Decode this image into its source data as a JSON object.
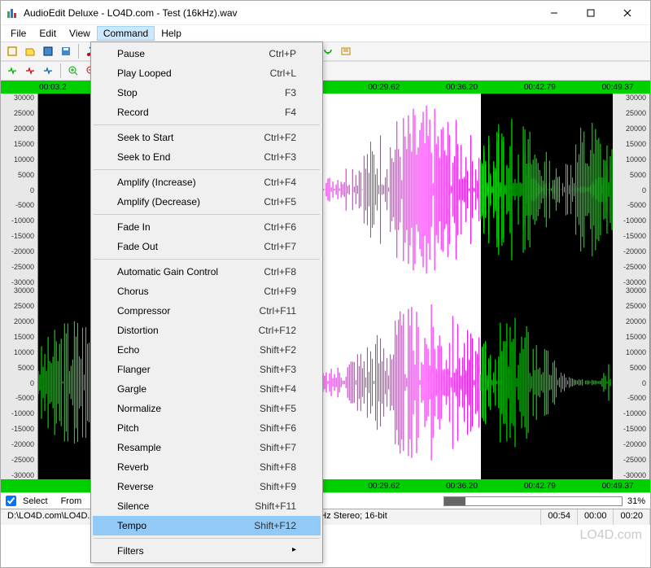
{
  "window": {
    "title": "AudioEdit Deluxe  -  LO4D.com - Test (16kHz).wav"
  },
  "menubar": {
    "items": [
      "File",
      "Edit",
      "View",
      "Command",
      "Help"
    ],
    "open_index": 3
  },
  "command_menu": {
    "groups": [
      [
        {
          "label": "Pause",
          "shortcut": "Ctrl+P"
        },
        {
          "label": "Play Looped",
          "shortcut": "Ctrl+L"
        },
        {
          "label": "Stop",
          "shortcut": "F3"
        },
        {
          "label": "Record",
          "shortcut": "F4"
        }
      ],
      [
        {
          "label": "Seek to Start",
          "shortcut": "Ctrl+F2"
        },
        {
          "label": "Seek to End",
          "shortcut": "Ctrl+F3"
        }
      ],
      [
        {
          "label": "Amplify (Increase)",
          "shortcut": "Ctrl+F4"
        },
        {
          "label": "Amplify (Decrease)",
          "shortcut": "Ctrl+F5"
        }
      ],
      [
        {
          "label": "Fade In",
          "shortcut": "Ctrl+F6"
        },
        {
          "label": "Fade Out",
          "shortcut": "Ctrl+F7"
        }
      ],
      [
        {
          "label": "Automatic Gain Control",
          "shortcut": "Ctrl+F8"
        },
        {
          "label": "Chorus",
          "shortcut": "Ctrl+F9"
        },
        {
          "label": "Compressor",
          "shortcut": "Ctrl+F11"
        },
        {
          "label": "Distortion",
          "shortcut": "Ctrl+F12"
        },
        {
          "label": "Echo",
          "shortcut": "Shift+F2"
        },
        {
          "label": "Flanger",
          "shortcut": "Shift+F3"
        },
        {
          "label": "Gargle",
          "shortcut": "Shift+F4"
        },
        {
          "label": "Normalize",
          "shortcut": "Shift+F5"
        },
        {
          "label": "Pitch",
          "shortcut": "Shift+F6"
        },
        {
          "label": "Resample",
          "shortcut": "Shift+F7"
        },
        {
          "label": "Reverb",
          "shortcut": "Shift+F8"
        },
        {
          "label": "Reverse",
          "shortcut": "Shift+F9"
        },
        {
          "label": "Silence",
          "shortcut": "Shift+F11"
        },
        {
          "label": "Tempo",
          "shortcut": "Shift+F12",
          "highlight": true
        }
      ],
      [
        {
          "label": "Filters",
          "submenu": true
        }
      ]
    ]
  },
  "timeline": {
    "ticks": [
      "00:03.2",
      "00:29.62",
      "00:36.20",
      "00:42.79",
      "00:49.37"
    ]
  },
  "amplitude_scale": {
    "labels": [
      "30000",
      "25000",
      "20000",
      "15000",
      "10000",
      "5000",
      "0",
      "-5000",
      "-10000",
      "-15000",
      "-20000",
      "-25000",
      "-30000"
    ]
  },
  "selection_bar": {
    "checkbox_label": "Select",
    "from_label": "From"
  },
  "progress": {
    "percent_label": "31%",
    "percent_value": 31
  },
  "statusbar": {
    "file": "D:\\LO4D.com\\LO4D.com - Test (16kHz).wav",
    "format": "Waveform Audio (WAV); 16000 Hz Stereo; 16-bit",
    "t1": "00:54",
    "t2": "00:00",
    "t3": "00:20"
  },
  "watermark": "LO4D.com",
  "toolbar1_icons": [
    "new-file-icon",
    "open-icon",
    "save-icon",
    "save-as-icon",
    "cut-icon",
    "copy-icon",
    "paste-icon",
    "undo-icon",
    "redo-icon",
    "seek-start-icon",
    "record-icon",
    "play-icon",
    "play-loop-icon",
    "pause-icon",
    "stop-icon",
    "vol-up-icon",
    "vol-down-icon",
    "settings-icon"
  ],
  "toolbar2_icons": [
    "wave-in-icon",
    "wave-out-icon",
    "wave-both-icon",
    "zoom-in-icon",
    "zoom-out-icon",
    "fit-icon",
    "sel-start-icon",
    "sel-end-icon",
    "marker-icon",
    "region-icon",
    "ruler-icon"
  ],
  "colors": {
    "timeline_bg": "#00d000",
    "wave_unselected": "#00ff00",
    "wave_selected": "#ff00ff",
    "wave_bg": "#000000",
    "selection_bg": "#ffffff",
    "menu_highlight": "#91c9f7"
  }
}
